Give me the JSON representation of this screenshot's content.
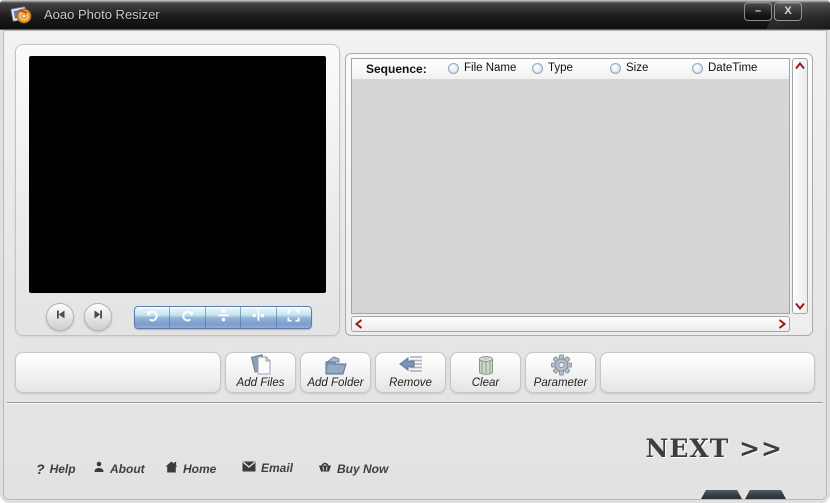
{
  "window": {
    "title": "Aoao Photo Resizer",
    "minimize_glyph": "–",
    "close_glyph": "X"
  },
  "preview": {
    "controls": [
      "skip-back",
      "skip-forward"
    ],
    "tools": [
      "rotate-left",
      "rotate-right",
      "flip-vertical",
      "flip-horizontal",
      "fit-screen"
    ]
  },
  "sequence": {
    "label": "Sequence:",
    "options": [
      {
        "label": "File Name",
        "selected": false
      },
      {
        "label": "Type",
        "selected": false
      },
      {
        "label": "Size",
        "selected": false
      },
      {
        "label": "DateTime",
        "selected": false
      }
    ]
  },
  "file_list": {
    "items": []
  },
  "toolbar": {
    "buttons": [
      {
        "label": "Add Files",
        "icon": "add-files-icon"
      },
      {
        "label": "Add Folder",
        "icon": "add-folder-icon"
      },
      {
        "label": "Remove",
        "icon": "remove-icon"
      },
      {
        "label": "Clear",
        "icon": "clear-icon"
      },
      {
        "label": "Parameter",
        "icon": "parameter-icon"
      }
    ]
  },
  "footer": {
    "next_label": "NEXT >>",
    "links": [
      {
        "label": "Help",
        "icon": "help-icon",
        "glyph": "?"
      },
      {
        "label": "About",
        "icon": "about-icon"
      },
      {
        "label": "Home",
        "icon": "home-icon"
      },
      {
        "label": "Email",
        "icon": "email-icon"
      },
      {
        "label": "Buy Now",
        "icon": "buy-now-icon"
      }
    ]
  },
  "colors": {
    "titlebar": "#1a1a1a",
    "accent_toolbar_blue": "#8fb5d8",
    "scroll_arrow_red": "#9b1b1b",
    "list_background": "#d6d6d6"
  }
}
